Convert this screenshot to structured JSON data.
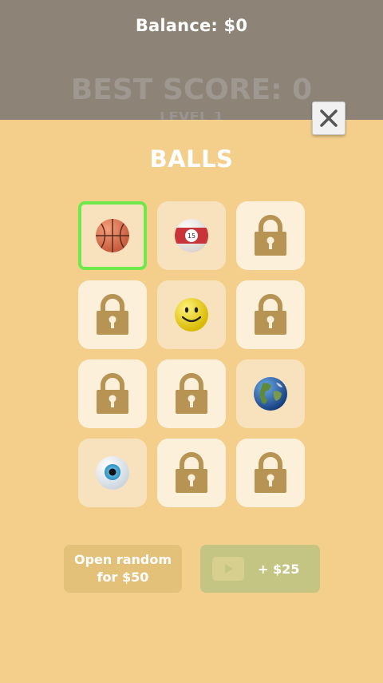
{
  "header": {
    "balance": "Balance: $0",
    "best_score": "BEST SCORE: 0",
    "peek_text": "LEVEL 1"
  },
  "panel": {
    "title": "BALLS",
    "balls": [
      {
        "name": "basketball",
        "state": "selected"
      },
      {
        "name": "billiard-ball-15",
        "state": "unlocked",
        "number": "15"
      },
      {
        "name": "locked",
        "state": "locked"
      },
      {
        "name": "locked",
        "state": "locked"
      },
      {
        "name": "smiley",
        "state": "unlocked"
      },
      {
        "name": "locked",
        "state": "locked"
      },
      {
        "name": "locked",
        "state": "locked"
      },
      {
        "name": "locked",
        "state": "locked"
      },
      {
        "name": "earth",
        "state": "unlocked"
      },
      {
        "name": "eyeball",
        "state": "unlocked"
      },
      {
        "name": "locked",
        "state": "locked"
      },
      {
        "name": "locked",
        "state": "locked"
      }
    ]
  },
  "buttons": {
    "open_random_line1": "Open random",
    "open_random_line2": "for $50",
    "watch_ad_reward": "+ $25"
  },
  "colors": {
    "panel": "#f4cf8c",
    "selected_border": "#6fe84a",
    "lock": "#b89454"
  }
}
